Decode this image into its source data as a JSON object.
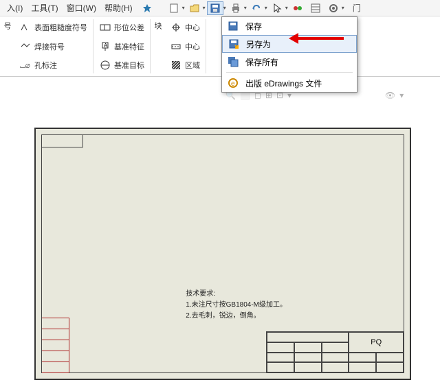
{
  "menubar": {
    "items": [
      "入(I)",
      "工具(T)",
      "窗口(W)",
      "帮助(H)"
    ]
  },
  "ribbon": {
    "left_label": "号",
    "group1": {
      "row1": "表面粗糙度符号",
      "row2": "焊接符号",
      "row3": "孔标注"
    },
    "group2": {
      "row1": "形位公差",
      "row2": "基准特征",
      "row3": "基准目标"
    },
    "group3_label": "块",
    "group4": {
      "row1": "中心",
      "row2": "中心",
      "row3": "区域"
    }
  },
  "dropdown": {
    "items": [
      {
        "label": "保存",
        "icon": "save"
      },
      {
        "label": "另存为",
        "icon": "save-as",
        "highlighted": true
      },
      {
        "label": "保存所有",
        "icon": "save-all"
      },
      {
        "label": "出版 eDrawings 文件",
        "icon": "edrawings"
      }
    ]
  },
  "drawing": {
    "notes_title": "技术要求:",
    "notes_line1": "1.未注尺寸按GB1804-M级加工。",
    "notes_line2": "2.去毛刺，锐边，倒角。",
    "title_block_label": "PQ"
  }
}
